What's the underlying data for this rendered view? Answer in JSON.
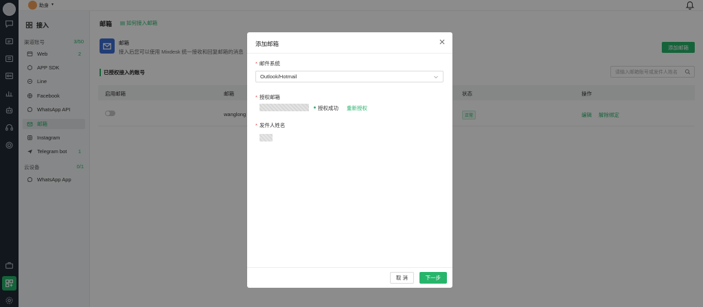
{
  "topbar": {
    "org_name": "助身",
    "caret": "▾"
  },
  "subnav": {
    "heading": "接入",
    "groups": [
      {
        "label": "渠道账号",
        "count": "3/50"
      },
      {
        "label": "云设备",
        "count": "0/1"
      }
    ],
    "items": [
      {
        "label": "Web",
        "count": "2",
        "icon": "browser-icon"
      },
      {
        "label": "APP SDK",
        "count": "",
        "icon": "cube-icon"
      },
      {
        "label": "Line",
        "count": "",
        "icon": "link-icon"
      },
      {
        "label": "Facebook",
        "count": "",
        "icon": "globe-icon"
      },
      {
        "label": "WhatsApp API",
        "count": "",
        "icon": "chat-icon"
      },
      {
        "label": "邮箱",
        "count": "",
        "icon": "mail-icon"
      },
      {
        "label": "Instagram",
        "count": "",
        "icon": "camera-icon"
      },
      {
        "label": "Telegram bot",
        "count": "1",
        "icon": "send-icon"
      },
      {
        "label": "WhatsApp App",
        "count": "",
        "icon": "chat-icon"
      }
    ]
  },
  "main": {
    "title": "邮箱",
    "help_link": "如何接入邮箱",
    "intro_title": "邮箱",
    "intro_desc": "接入后您可以使用 Mixdesk 统一接收和回复邮箱的消息",
    "add_button": "添加邮箱",
    "section_title": "已授权接入的账号",
    "search_placeholder": "请输入邮箱账号或发件人姓名",
    "columns": {
      "enable": "启用邮箱",
      "email": "邮箱",
      "status": "状态",
      "actions": "操作"
    },
    "row": {
      "email": "wanglong",
      "status": "正常",
      "edit": "编辑",
      "unbind": "解除绑定"
    }
  },
  "modal": {
    "title": "添加邮箱",
    "fields": {
      "system_label": "邮件系统",
      "system_value": "Outlook/Hotmail",
      "auth_label": "授权邮箱",
      "auth_status": "授权成功",
      "reauth": "重新授权",
      "sender_label": "发件人姓名"
    },
    "required_mark": "*",
    "cancel": "取 消",
    "next": "下一步"
  },
  "colors": {
    "accent": "#27b56b",
    "rail": "#1f2a36",
    "mail_icon_bg": "#3c6fd8"
  }
}
